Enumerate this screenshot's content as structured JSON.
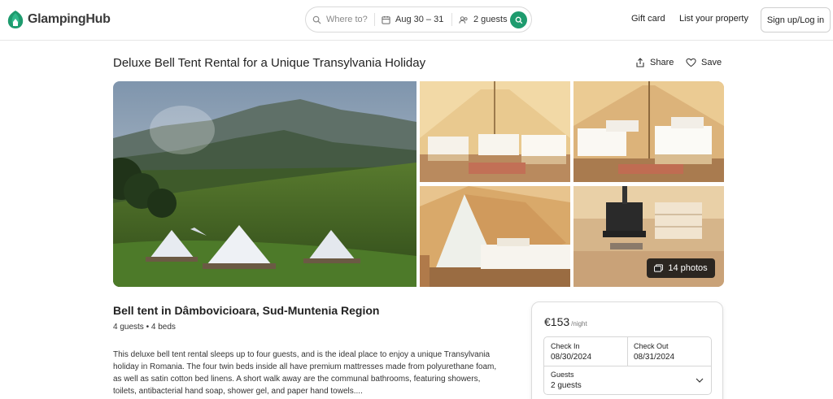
{
  "header": {
    "brand": "GlampingHub",
    "search": {
      "where_placeholder": "Where to?",
      "dates": "Aug 30 – 31",
      "guests": "2 guests"
    },
    "nav": {
      "gift_card": "Gift card",
      "list_property": "List your property",
      "signup": "Sign up/Log in"
    },
    "colors": {
      "accent": "#1e9b6e"
    }
  },
  "listing": {
    "title": "Deluxe Bell Tent Rental for a Unique Transylvania Holiday",
    "actions": {
      "share": "Share",
      "save": "Save"
    },
    "gallery": {
      "photos_button": "14 photos",
      "images": [
        "mountain-meadow-bell-tents",
        "tent-interior-three-beds",
        "tent-interior-two-beds",
        "tent-entrance-view",
        "tent-stove-dresser"
      ]
    },
    "subtitle": "Bell tent in Dâmbovicioara, Sud-Muntenia Region",
    "meta": "4 guests • 4 beds",
    "description": [
      "This deluxe bell tent rental sleeps up to four guests, and is the ideal place to enjoy a unique Transylvania",
      "holiday in Romania. The four twin beds inside all have premium mattresses made from polyurethane foam,",
      "as well as satin cotton bed linens. A short walk away are the communal bathrooms, featuring showers,",
      "toilets, antibacterial hand soap, shower gel, and paper hand towels...."
    ]
  },
  "booking": {
    "price": "€153",
    "price_unit": "/night",
    "check_in_label": "Check In",
    "check_in_value": "08/30/2024",
    "check_out_label": "Check Out",
    "check_out_value": "08/31/2024",
    "guests_label": "Guests",
    "guests_value": "2 guests"
  }
}
